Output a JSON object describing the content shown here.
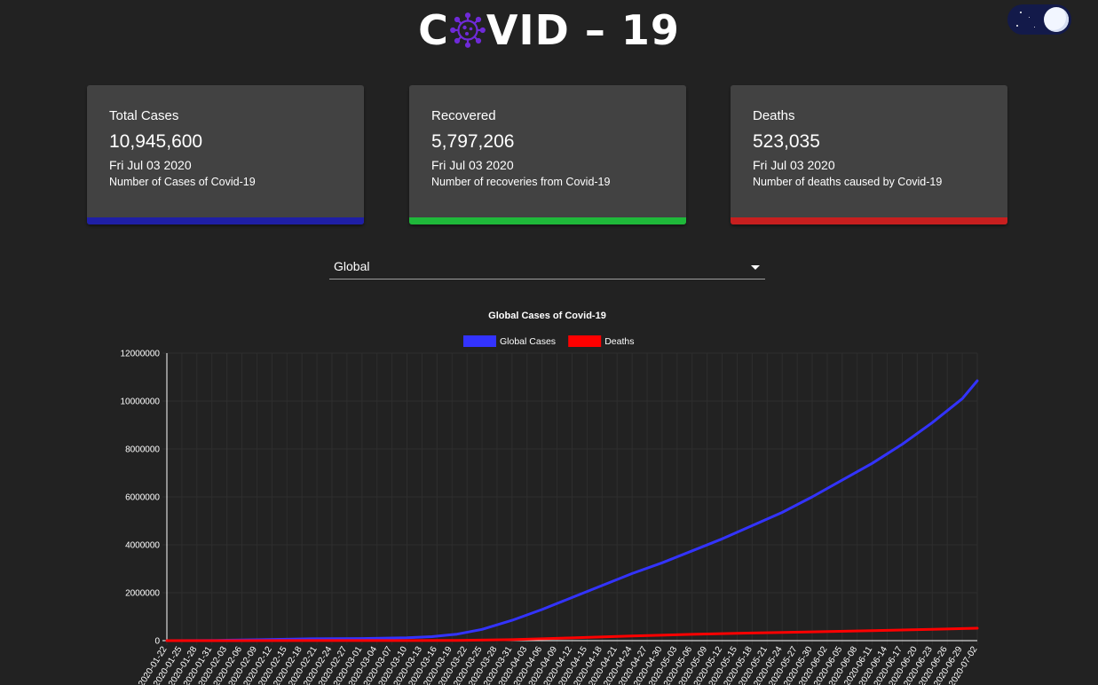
{
  "header": {
    "title_pre": "C",
    "title_post": "VID – 19",
    "virus_icon": "virus-icon"
  },
  "theme_toggle": {
    "icon": "moon-icon",
    "state": "dark"
  },
  "cards": [
    {
      "title": "Total Cases",
      "value": "10,945,600",
      "date": "Fri Jul 03 2020",
      "description": "Number of Cases of Covid-19",
      "color": "#1f1fa6"
    },
    {
      "title": "Recovered",
      "value": "5,797,206",
      "date": "Fri Jul 03 2020",
      "description": "Number of recoveries from Covid-19",
      "color": "#1fb83a"
    },
    {
      "title": "Deaths",
      "value": "523,035",
      "date": "Fri Jul 03 2020",
      "description": "Number of deaths caused by Covid-19",
      "color": "#c81f1f"
    }
  ],
  "country_select": {
    "value": "Global"
  },
  "chart_data": {
    "type": "line",
    "title": "Global Cases of Covid-19",
    "xlabel": "",
    "ylabel": "",
    "ylim": [
      0,
      12000000
    ],
    "yticks": [
      0,
      2000000,
      4000000,
      6000000,
      8000000,
      10000000,
      12000000
    ],
    "grid": true,
    "legend_position": "top",
    "x_start": "2020-01-22",
    "x_end": "2020-07-02",
    "tick_every_days": 3,
    "series": [
      {
        "name": "Global Cases",
        "color": "#3333ff",
        "points": [
          [
            "2020-01-22",
            555
          ],
          [
            "2020-02-01",
            12000
          ],
          [
            "2020-02-10",
            40000
          ],
          [
            "2020-02-20",
            76000
          ],
          [
            "2020-03-01",
            88000
          ],
          [
            "2020-03-10",
            119000
          ],
          [
            "2020-03-15",
            167000
          ],
          [
            "2020-03-20",
            272000
          ],
          [
            "2020-03-25",
            470000
          ],
          [
            "2020-03-31",
            850000
          ],
          [
            "2020-04-06",
            1300000
          ],
          [
            "2020-04-12",
            1800000
          ],
          [
            "2020-04-18",
            2300000
          ],
          [
            "2020-04-24",
            2800000
          ],
          [
            "2020-04-30",
            3250000
          ],
          [
            "2020-05-06",
            3750000
          ],
          [
            "2020-05-12",
            4250000
          ],
          [
            "2020-05-18",
            4800000
          ],
          [
            "2020-05-24",
            5350000
          ],
          [
            "2020-05-30",
            6000000
          ],
          [
            "2020-06-05",
            6700000
          ],
          [
            "2020-06-11",
            7400000
          ],
          [
            "2020-06-17",
            8200000
          ],
          [
            "2020-06-23",
            9100000
          ],
          [
            "2020-06-29",
            10100000
          ],
          [
            "2020-07-02",
            10850000
          ]
        ]
      },
      {
        "name": "Deaths",
        "color": "#ff0000",
        "points": [
          [
            "2020-01-22",
            17
          ],
          [
            "2020-02-20",
            2250
          ],
          [
            "2020-03-10",
            4300
          ],
          [
            "2020-03-20",
            11000
          ],
          [
            "2020-03-31",
            42000
          ],
          [
            "2020-04-12",
            114000
          ],
          [
            "2020-04-24",
            197000
          ],
          [
            "2020-05-06",
            262000
          ],
          [
            "2020-05-18",
            318000
          ],
          [
            "2020-05-30",
            368000
          ],
          [
            "2020-06-11",
            418000
          ],
          [
            "2020-06-23",
            472000
          ],
          [
            "2020-07-02",
            518000
          ]
        ]
      }
    ]
  }
}
